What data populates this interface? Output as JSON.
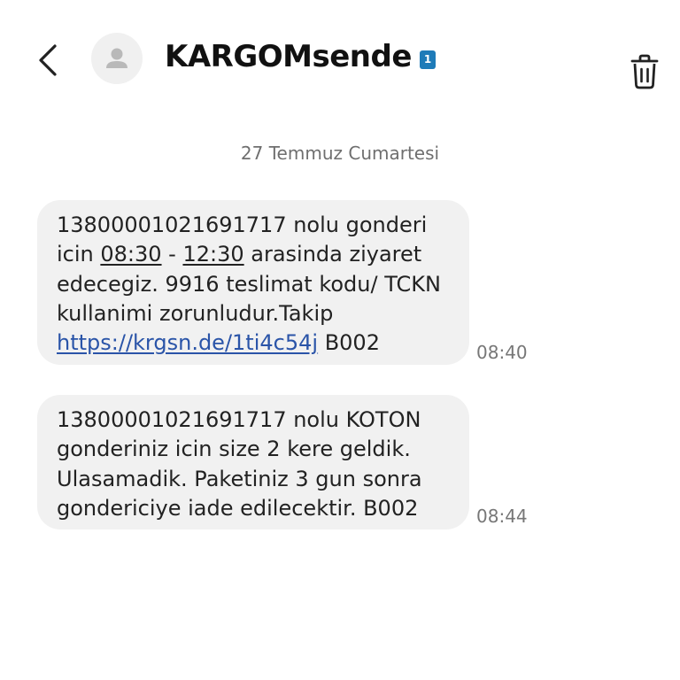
{
  "header": {
    "back_icon": "chevron-left-icon",
    "avatar_icon": "person-icon",
    "contact_name": "KARGOMsende",
    "sim_badge": "1",
    "delete_icon": "trash-icon"
  },
  "conversation": {
    "date_separator": "27 Temmuz Cumartesi",
    "messages": [
      {
        "direction": "incoming",
        "parts": {
          "p1": "13800001021691717 nolu gonderi icin ",
          "t1": "08:30",
          "p2": " - ",
          "t2": "12:30",
          "p3": " arasinda ziyaret edecegiz. 9916 teslimat kodu/ TCKN kullanimi zorunludur.Takip ",
          "link": "https://krgsn.de/1ti4c54j",
          "p4": " B002"
        },
        "time": "08:40"
      },
      {
        "direction": "incoming",
        "text": "13800001021691717 nolu KOTON gonderiniz icin size 2 kere geldik. Ulasamadik. Paketiniz 3 gun sonra gondericiye iade edilecektir. B002",
        "time": "08:44"
      }
    ]
  },
  "colors": {
    "background": "#ffffff",
    "bubble": "#f1f1f1",
    "link": "#2a54a8",
    "badge": "#1e7bb8",
    "meta_text": "#777777"
  }
}
